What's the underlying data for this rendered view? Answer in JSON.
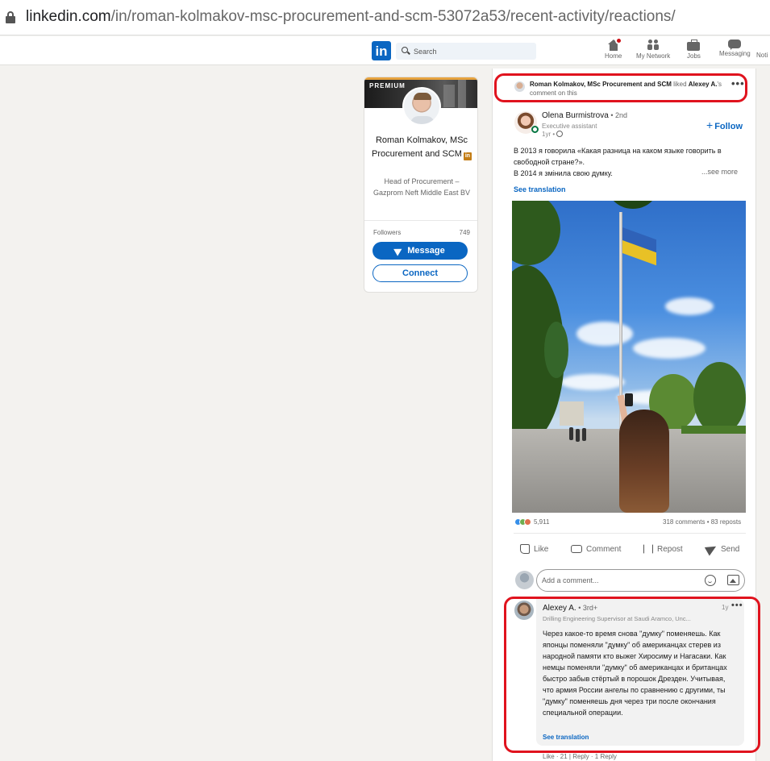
{
  "browser": {
    "url_domain": "linkedin.com",
    "url_path": "/in/roman-kolmakov-msc-procurement-and-scm-53072a53/recent-activity/reactions/"
  },
  "nav": {
    "logo": "in",
    "search_placeholder": "Search",
    "items": [
      {
        "label": "Home",
        "icon": "home-icon"
      },
      {
        "label": "My Network",
        "icon": "network-icon"
      },
      {
        "label": "Jobs",
        "icon": "jobs-icon"
      },
      {
        "label": "Messaging",
        "icon": "messaging-icon"
      },
      {
        "label": "Noti",
        "icon": "notifications-icon"
      }
    ]
  },
  "profile": {
    "badge": "PREMIUM",
    "name": "Roman Kolmakov, MSc Procurement and SCM",
    "headline": "Head of Procurement – Gazprom Neft Middle East BV",
    "followers_label": "Followers",
    "followers_count": "749",
    "message_label": "Message",
    "connect_label": "Connect"
  },
  "activity": {
    "actor": "Roman Kolmakov, MSc Procurement and SCM",
    "verb": " liked ",
    "target": "Alexey A.",
    "suffix": "'s comment on this"
  },
  "post": {
    "author": "Olena Burmistrova",
    "degree": " • 2nd",
    "title": "Executive assistant",
    "time": "1yr •",
    "follow_label": "Follow",
    "text_line1": "В 2013 я говорила «Какая разница на каком языке говорить в свободной стране?».",
    "text_line2": "В 2014 я змінила свою думку.",
    "see_more": "...see more",
    "see_translation": "See translation",
    "reactions_count": "5,911",
    "comments_reposts": "318 comments • 83 reposts",
    "actions": {
      "like": "Like",
      "comment": "Comment",
      "repost": "Repost",
      "send": "Send"
    },
    "comment_placeholder": "Add a comment..."
  },
  "comment": {
    "author": "Alexey A.",
    "degree": " • 3rd+",
    "title": "Drilling Engineering Supervisor at Saudi Aramco, Unc...",
    "time": "1y",
    "text": "Через какое-то время снова \"думку\" поменяешь. Как японцы поменяли \"думку\" об американцах стерев из народной памяти кто выжег Хиросиму и Нагасаки. Как немцы поменяли \"думку\" об американцах и британцах быстро забыв стёртый в порошок Дрезден. Учитывая, что армия России ангелы по сравнению с другими, ты \"думку\" поменяешь дня через три после окончания специальной операции.",
    "see_translation": "See translation",
    "footer": "Like · 21 | Reply · 1 Reply"
  },
  "colors": {
    "linkedin_blue": "#0a66c2",
    "highlight_red": "#e0131e",
    "premium_gold": "#e7a33e"
  }
}
